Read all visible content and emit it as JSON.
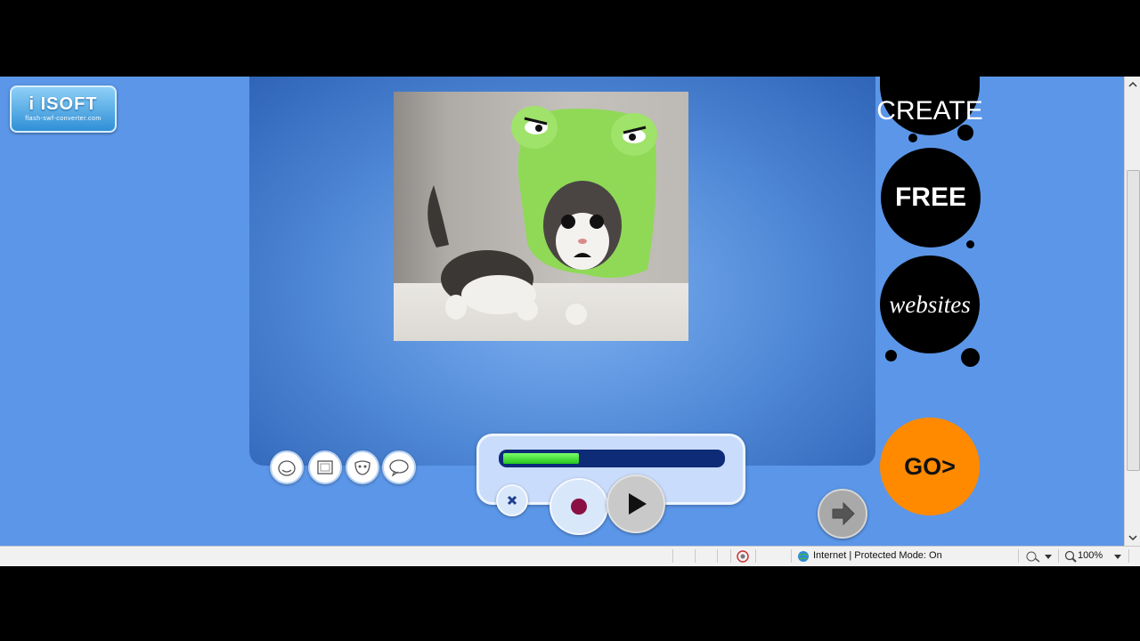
{
  "logo": {
    "main": "i ISOFT",
    "sub": "flash-swf-converter.com"
  },
  "ad": {
    "line1": "CREATE",
    "line2": "FREE",
    "line3": "websites",
    "go_label": "GO>"
  },
  "player": {
    "progress": 0.35
  },
  "statusbar": {
    "zone_text": "Internet | Protected Mode: On",
    "zoom_text": "100%"
  },
  "colors": {
    "page_bg": "#5b96e8",
    "go_orange": "#ff8a00",
    "progress_green": "#26c71c",
    "track_navy": "#0e2b78"
  }
}
